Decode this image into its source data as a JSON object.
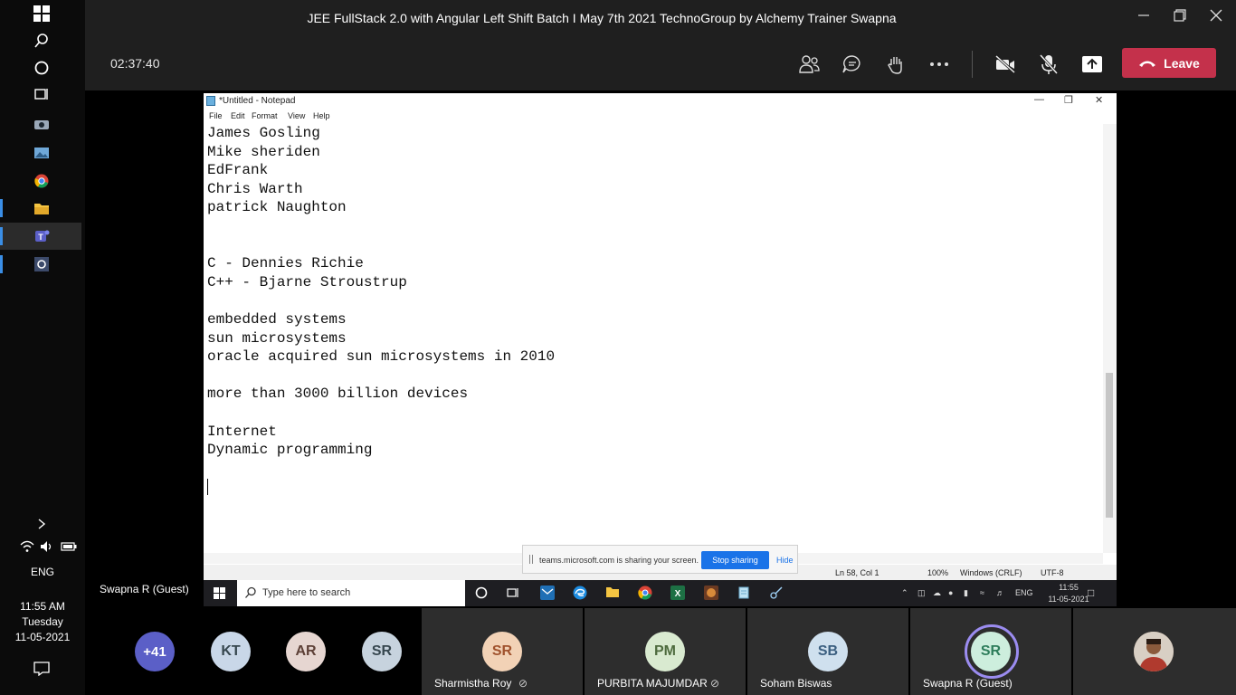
{
  "meeting": {
    "title": "JEE FullStack 2.0 with Angular Left Shift Batch I May 7th 2021 TechnoGroup by Alchemy Trainer Swapna",
    "timer": "02:37:40",
    "leave_label": "Leave",
    "presenter_label": "Swapna R (Guest)"
  },
  "side_rail": {
    "language": "ENG",
    "time": "11:55 AM",
    "day": "Tuesday",
    "date": "11-05-2021"
  },
  "notepad": {
    "title": "*Untitled - Notepad",
    "menu": [
      "File",
      "Edit",
      "Format",
      "View",
      "Help"
    ],
    "lines": [
      "James Gosling",
      "Mike sheriden",
      "EdFrank",
      "Chris Warth",
      "patrick Naughton",
      "",
      "",
      "C - Dennies Richie",
      "C++ - Bjarne Stroustrup",
      "",
      "embedded systems",
      "sun microsystems",
      "oracle acquired sun microsystems in 2010",
      "",
      "more than 3000 billion devices",
      "",
      "Internet",
      "Dynamic programming",
      ""
    ],
    "status": {
      "position": "Ln 58, Col 1",
      "zoom": "100%",
      "line_ending": "Windows (CRLF)",
      "encoding": "UTF-8"
    }
  },
  "share_bar": {
    "message": "teams.microsoft.com is sharing your screen.",
    "stop_label": "Stop sharing",
    "hide_label": "Hide"
  },
  "inner_taskbar": {
    "search_placeholder": "Type here to search",
    "language": "ENG",
    "time": "11:55",
    "date": "11-05-2021"
  },
  "participants": {
    "overflow": "+41",
    "small": [
      {
        "initials": "KT",
        "color": "#c9d7e8"
      },
      {
        "initials": "AR",
        "color": "#e6d6d1"
      },
      {
        "initials": "SR",
        "color": "#c7d3de"
      }
    ],
    "tiles": [
      {
        "initials": "SR",
        "name": "Sharmistha Roy",
        "color": "#f2d2b6",
        "muted": true
      },
      {
        "initials": "PM",
        "name": "PURBITA MAJUMDAR",
        "color": "#d9ead0",
        "muted": true
      },
      {
        "initials": "SB",
        "name": "Soham Biswas",
        "color": "#cfe0ee",
        "muted": false
      },
      {
        "initials": "SR",
        "name": "Swapna R (Guest)",
        "color": "#cdeedd",
        "muted": false
      }
    ]
  },
  "colors": {
    "leave": "#c4314b",
    "chrome": "#1f1f1f",
    "speaking_ring": "#9b8cf0",
    "overflow_avatar": "#5b5fc7"
  }
}
